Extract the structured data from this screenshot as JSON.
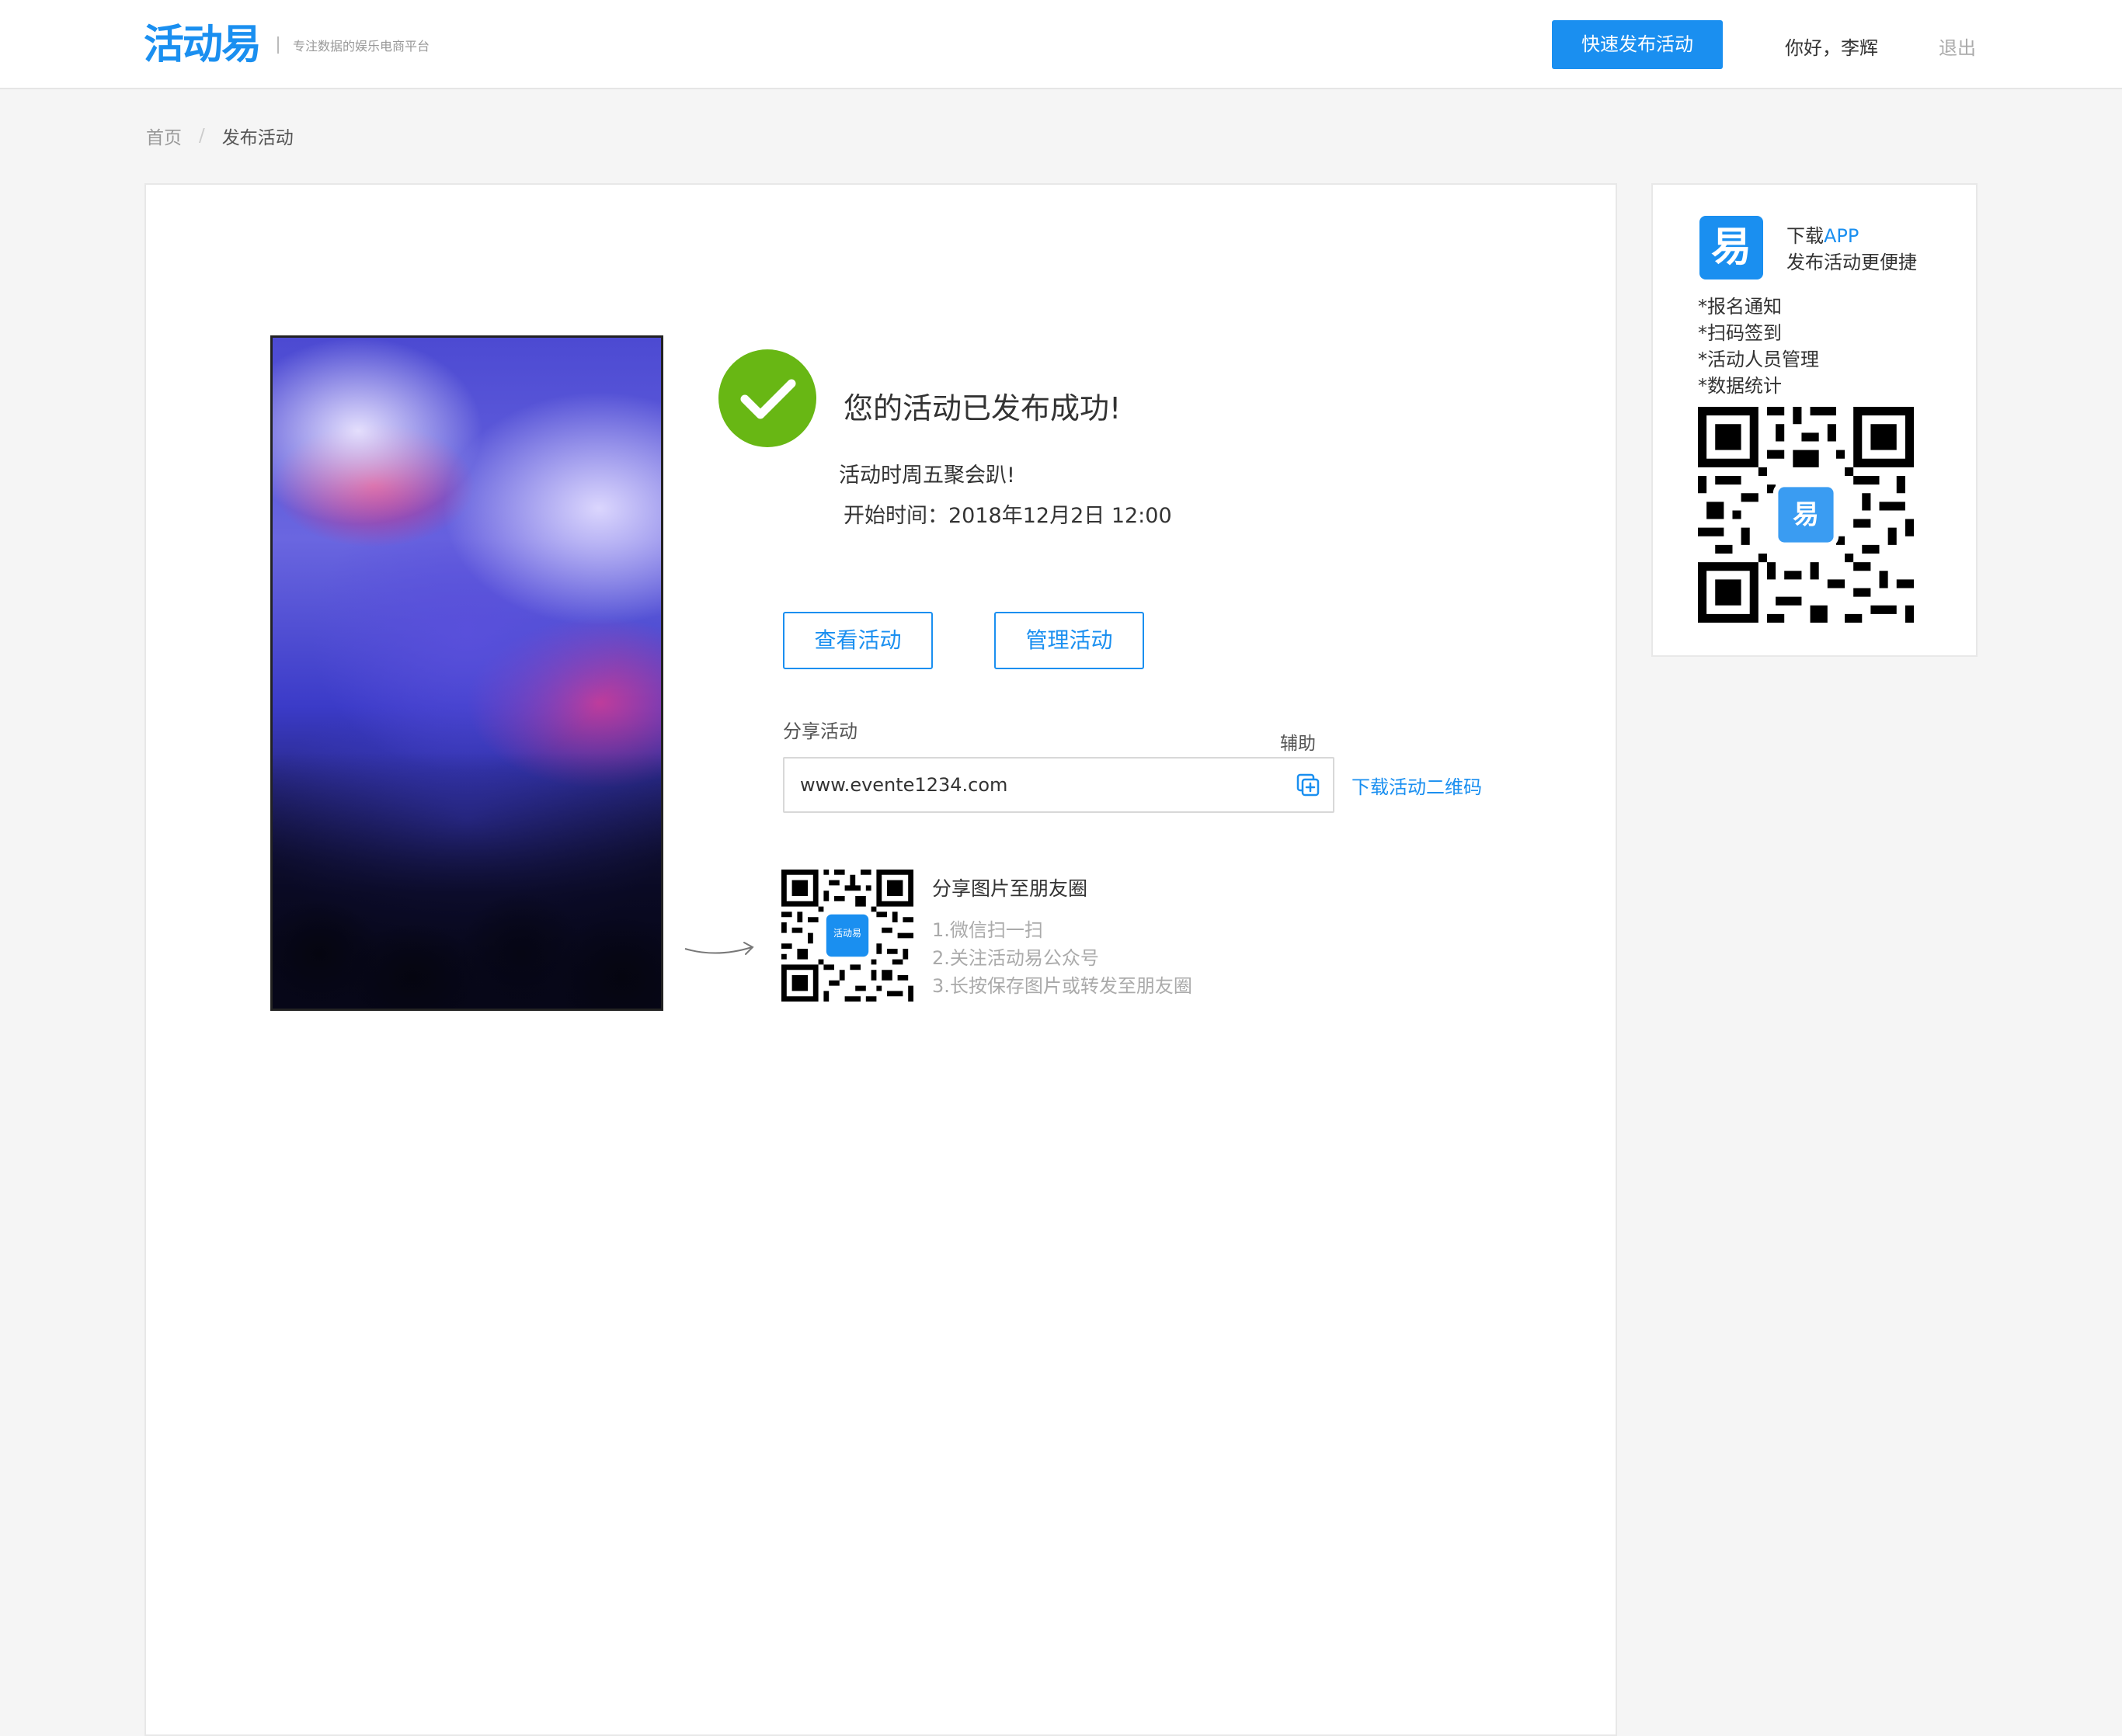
{
  "header": {
    "logo": "活动易",
    "tagline": "专注数据的娱乐电商平台",
    "publish_button": "快速发布活动",
    "greeting": "你好，李辉",
    "logout": "退出"
  },
  "breadcrumb": {
    "home": "首页",
    "separator": "/",
    "current": "发布活动"
  },
  "main": {
    "success_message": "您的活动已发布成功!",
    "event_title": "活动时周五聚会趴!",
    "event_time": "开始时间：2018年12月2日 12:00",
    "view_button": "查看活动",
    "manage_button": "管理活动",
    "share_label": "分享活动",
    "assist_label": "辅助",
    "share_url": "www.evente1234.com",
    "download_qr": "下载活动二维码",
    "wechat": {
      "title": "分享图片至朋友圈",
      "steps": [
        "1.微信扫一扫",
        "2.关注活动易公众号",
        "3.长按保存图片或转发至朋友圈"
      ],
      "qr_logo": "活动易"
    }
  },
  "sidebar": {
    "app_icon": "易",
    "download_text": "下载",
    "download_app": "APP",
    "subtitle": "发布活动更便捷",
    "features": [
      "*报名通知",
      "*扫码签到",
      "*活动人员管理",
      "*数据统计"
    ],
    "qr_logo": "易"
  },
  "colors": {
    "accent": "#1a8ff0",
    "success": "#68b714",
    "muted": "#aaaaaa"
  },
  "icons": [
    "check-icon",
    "copy-icon",
    "arrow-icon",
    "qr-code-icon"
  ]
}
